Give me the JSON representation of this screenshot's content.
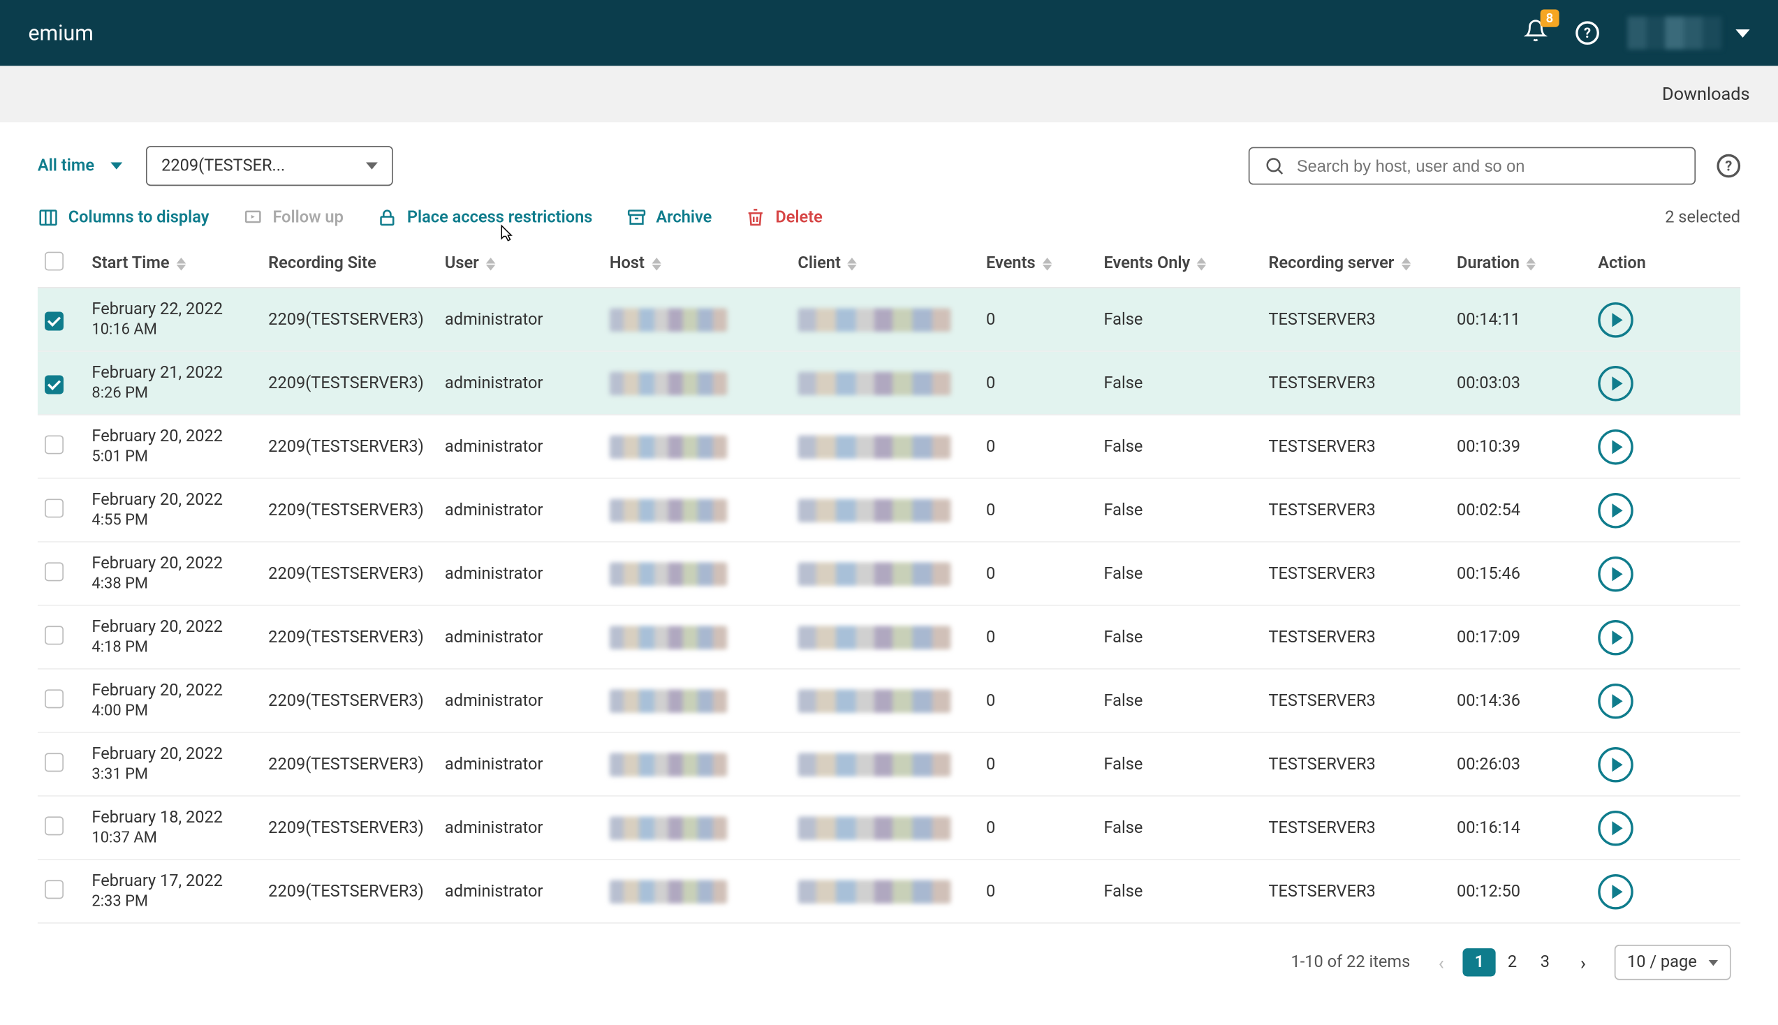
{
  "topbar": {
    "title_fragment": "emium",
    "notification_count": "8"
  },
  "subbar": {
    "downloads_label": "Downloads"
  },
  "filters": {
    "time_label": "All time",
    "site_selected": "2209(TESTSER...",
    "search_placeholder": "Search by host, user and so on"
  },
  "actions": {
    "columns": "Columns to display",
    "followup": "Follow up",
    "restrictions": "Place access restrictions",
    "archive": "Archive",
    "delete": "Delete",
    "selected_text": "2 selected"
  },
  "columns": {
    "start": "Start Time",
    "site": "Recording Site",
    "user": "User",
    "host": "Host",
    "client": "Client",
    "events": "Events",
    "events_only": "Events Only",
    "server": "Recording server",
    "duration": "Duration",
    "action": "Action"
  },
  "rows": [
    {
      "checked": true,
      "date": "February 22, 2022",
      "time": "10:16 AM",
      "site": "2209(TESTSERVER3)",
      "user": "administrator",
      "events": "0",
      "events_only": "False",
      "server": "TESTSERVER3",
      "duration": "00:14:11"
    },
    {
      "checked": true,
      "date": "February 21, 2022",
      "time": "8:26 PM",
      "site": "2209(TESTSERVER3)",
      "user": "administrator",
      "events": "0",
      "events_only": "False",
      "server": "TESTSERVER3",
      "duration": "00:03:03"
    },
    {
      "checked": false,
      "date": "February 20, 2022",
      "time": "5:01 PM",
      "site": "2209(TESTSERVER3)",
      "user": "administrator",
      "events": "0",
      "events_only": "False",
      "server": "TESTSERVER3",
      "duration": "00:10:39"
    },
    {
      "checked": false,
      "date": "February 20, 2022",
      "time": "4:55 PM",
      "site": "2209(TESTSERVER3)",
      "user": "administrator",
      "events": "0",
      "events_only": "False",
      "server": "TESTSERVER3",
      "duration": "00:02:54"
    },
    {
      "checked": false,
      "date": "February 20, 2022",
      "time": "4:38 PM",
      "site": "2209(TESTSERVER3)",
      "user": "administrator",
      "events": "0",
      "events_only": "False",
      "server": "TESTSERVER3",
      "duration": "00:15:46"
    },
    {
      "checked": false,
      "date": "February 20, 2022",
      "time": "4:18 PM",
      "site": "2209(TESTSERVER3)",
      "user": "administrator",
      "events": "0",
      "events_only": "False",
      "server": "TESTSERVER3",
      "duration": "00:17:09"
    },
    {
      "checked": false,
      "date": "February 20, 2022",
      "time": "4:00 PM",
      "site": "2209(TESTSERVER3)",
      "user": "administrator",
      "events": "0",
      "events_only": "False",
      "server": "TESTSERVER3",
      "duration": "00:14:36"
    },
    {
      "checked": false,
      "date": "February 20, 2022",
      "time": "3:31 PM",
      "site": "2209(TESTSERVER3)",
      "user": "administrator",
      "events": "0",
      "events_only": "False",
      "server": "TESTSERVER3",
      "duration": "00:26:03"
    },
    {
      "checked": false,
      "date": "February 18, 2022",
      "time": "10:37 AM",
      "site": "2209(TESTSERVER3)",
      "user": "administrator",
      "events": "0",
      "events_only": "False",
      "server": "TESTSERVER3",
      "duration": "00:16:14"
    },
    {
      "checked": false,
      "date": "February 17, 2022",
      "time": "2:33 PM",
      "site": "2209(TESTSERVER3)",
      "user": "administrator",
      "events": "0",
      "events_only": "False",
      "server": "TESTSERVER3",
      "duration": "00:12:50"
    }
  ],
  "footer": {
    "range": "1-10 of 22 items",
    "pages": [
      "1",
      "2",
      "3"
    ],
    "current_page": "1",
    "page_size": "10 / page"
  }
}
